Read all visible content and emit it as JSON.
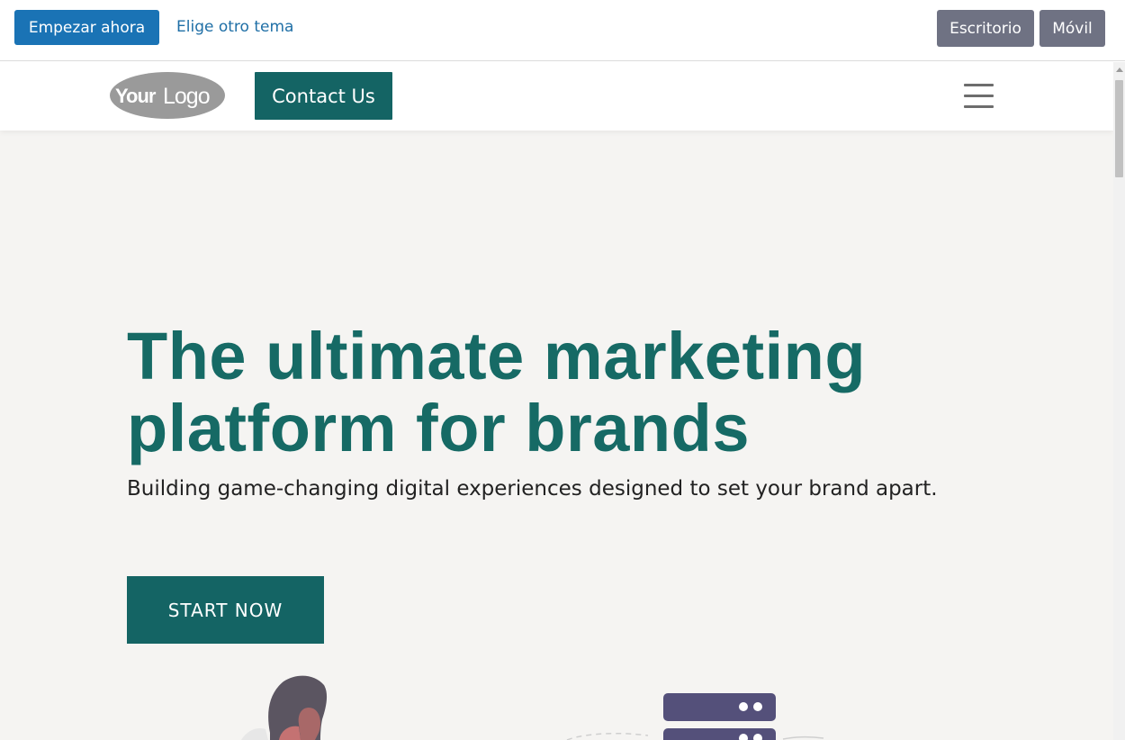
{
  "topbar": {
    "start_label": "Empezar ahora",
    "theme_link": "Elige otro tema",
    "desktop_label": "Escritorio",
    "mobile_label": "Móvil"
  },
  "header": {
    "logo_text": "YourLogo",
    "contact_label": "Contact Us"
  },
  "hero": {
    "title": "The ultimate marketing platform for brands",
    "subtitle": "Building game-changing digital experiences designed to set your brand apart.",
    "cta_label": "START NOW"
  },
  "colors": {
    "primary": "#146464",
    "title": "#166a65",
    "topbar_button": "#1a73b5",
    "device_button": "#6f7283",
    "background": "#f5f4f2"
  },
  "icons": {
    "menu": "hamburger-menu-icon",
    "logo": "logo-icon"
  }
}
